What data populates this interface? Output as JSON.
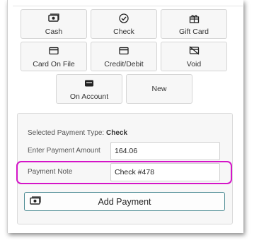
{
  "payment_types": [
    {
      "label": "Cash",
      "icon": "cash-icon"
    },
    {
      "label": "Check",
      "icon": "check-circle-icon"
    },
    {
      "label": "Gift Card",
      "icon": "gift-card-icon"
    },
    {
      "label": "Card On File",
      "icon": "credit-card-icon"
    },
    {
      "label": "Credit/Debit",
      "icon": "credit-card-icon"
    },
    {
      "label": "Void",
      "icon": "void-card-icon"
    },
    {
      "label": "On Account",
      "icon": "wallet-icon"
    },
    {
      "label": "New",
      "icon": ""
    }
  ],
  "selected_type": {
    "label": "Selected Payment Type:",
    "value": "Check"
  },
  "amount": {
    "label": "Enter Payment Amount",
    "value": "164.06"
  },
  "note": {
    "label": "Payment Note",
    "value": "Check #478"
  },
  "add_payment": {
    "label": "Add Payment",
    "icon": "cash-icon"
  },
  "highlight_color": "#d415c8",
  "accent_color": "#4f8d95"
}
